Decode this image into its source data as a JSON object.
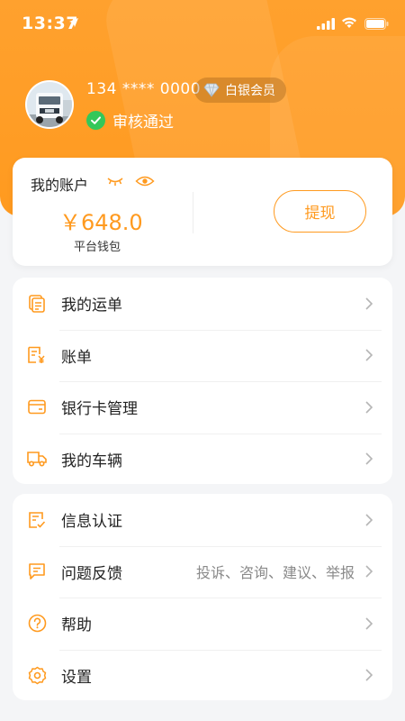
{
  "status_bar": {
    "time": "13:37"
  },
  "profile": {
    "phone": "134 **** 0000",
    "member_badge": "白银会员",
    "verify_status": "审核通过"
  },
  "account": {
    "title": "我的账户",
    "balance": "￥648.0",
    "wallet_label": "平台钱包",
    "withdraw_label": "提现"
  },
  "menu_group1": [
    {
      "label": "我的运单",
      "icon": "waybill-icon"
    },
    {
      "label": "账单",
      "icon": "bill-icon"
    },
    {
      "label": "银行卡管理",
      "icon": "bank-card-icon"
    },
    {
      "label": "我的车辆",
      "icon": "truck-icon"
    }
  ],
  "menu_group2": [
    {
      "label": "信息认证",
      "icon": "certificate-icon"
    },
    {
      "label": "问题反馈",
      "icon": "feedback-icon",
      "hint": "投诉、咨询、建议、举报"
    },
    {
      "label": "帮助",
      "icon": "help-icon"
    },
    {
      "label": "设置",
      "icon": "settings-icon"
    }
  ],
  "colors": {
    "accent": "#ff9a1f",
    "success": "#34c759",
    "background": "#f4f5f7"
  }
}
